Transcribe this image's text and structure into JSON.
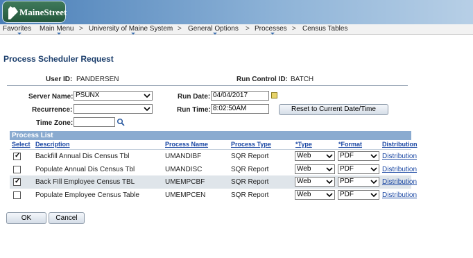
{
  "app": {
    "logo_text": "MaineStreet"
  },
  "nav": {
    "items": [
      "Favorites",
      "Main Menu",
      "University of Maine System",
      "General Options",
      "Processes",
      "Census Tables"
    ],
    "separator": ">"
  },
  "page": {
    "title": "Process Scheduler Request"
  },
  "header": {
    "user_id_label": "User ID:",
    "user_id": "PANDERSEN",
    "run_control_label": "Run Control ID:",
    "run_control": "BATCH"
  },
  "form": {
    "server_name_label": "Server Name:",
    "server_name": "PSUNX",
    "recurrence_label": "Recurrence:",
    "recurrence": "",
    "time_zone_label": "Time Zone:",
    "time_zone": "",
    "run_date_label": "Run Date:",
    "run_date": "04/04/2017",
    "run_time_label": "Run Time:",
    "run_time": "8:02:50AM",
    "reset_label": "Reset to Current Date/Time"
  },
  "process_list": {
    "title": "Process List",
    "headers": {
      "select": "Select",
      "description": "Description",
      "process_name": "Process Name",
      "process_type": "Process Type",
      "type": "*Type",
      "format": "*Format",
      "distribution": "Distribution"
    },
    "rows": [
      {
        "checked": true,
        "description": "Backfill Annual Dis Census Tbl",
        "process_name": "UMANDIBF",
        "process_type": "SQR Report",
        "type": "Web",
        "format": "PDF",
        "distribution": "Distribution"
      },
      {
        "checked": false,
        "description": "Populate Annual Dis Census Tbl",
        "process_name": "UMANDISC",
        "process_type": "SQR Report",
        "type": "Web",
        "format": "PDF",
        "distribution": "Distribution"
      },
      {
        "checked": true,
        "description": "Back FIll Employee Census TBL",
        "process_name": "UMEMPCBF",
        "process_type": "SQR Report",
        "type": "Web",
        "format": "PDF",
        "distribution": "Distribution"
      },
      {
        "checked": false,
        "description": "Populate Employee Census Table",
        "process_name": "UMEMPCEN",
        "process_type": "SQR Report",
        "type": "Web",
        "format": "PDF",
        "distribution": "Distribution"
      }
    ]
  },
  "actions": {
    "ok": "OK",
    "cancel": "Cancel"
  },
  "colors": {
    "accent": "#1a47a3",
    "title": "#1a3d6b",
    "grid_header": "#8aabd0"
  }
}
